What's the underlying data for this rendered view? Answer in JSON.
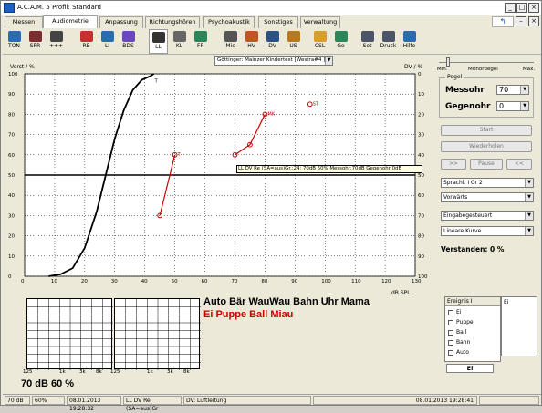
{
  "window": {
    "title": "A.C.A.M. 5  Profil: Standard"
  },
  "tabs": [
    {
      "label": "Messen",
      "active": false
    },
    {
      "label": "Audiometrie",
      "active": true
    },
    {
      "label": "Anpassung",
      "active": false
    },
    {
      "label": "Richtungshören",
      "active": false
    },
    {
      "label": "Psychoakustik",
      "active": false
    },
    {
      "label": "Sonstiges",
      "active": false
    },
    {
      "label": "Verwaltung",
      "active": false
    }
  ],
  "toolbar": [
    {
      "label": "TON",
      "icon": "tone-icon"
    },
    {
      "label": "SPR",
      "icon": "speech-icon"
    },
    {
      "label": "+++",
      "icon": "plus-icon"
    },
    {
      "label": "RE",
      "icon": "ear-right-icon"
    },
    {
      "label": "LI",
      "icon": "ear-left-icon"
    },
    {
      "label": "BDS",
      "icon": "ears-both-icon"
    },
    {
      "label": "LL",
      "icon": "headphones-icon",
      "selected": true
    },
    {
      "label": "KL",
      "icon": "bone-icon"
    },
    {
      "label": "FF",
      "icon": "speaker-icon"
    },
    {
      "label": "Mic",
      "icon": "mic-icon"
    },
    {
      "label": "HV",
      "icon": "hv-icon"
    },
    {
      "label": "DV",
      "icon": "dv-icon"
    },
    {
      "label": "US",
      "icon": "us-icon"
    },
    {
      "label": "CSL",
      "icon": "smiley-icon"
    },
    {
      "label": "Go",
      "icon": "go-icon"
    },
    {
      "label": "Set",
      "icon": "tools-icon"
    },
    {
      "label": "Druck",
      "icon": "printer-icon"
    },
    {
      "label": "Hilfe",
      "icon": "help-icon"
    }
  ],
  "test_select": {
    "value": "Göttinger: Mainzer Kindertest [Westra#4 ]"
  },
  "slider": {
    "min_label": "Min.",
    "mid_label": "Mithörpegel",
    "max_label": "Max."
  },
  "pegel": {
    "title": "Pegel",
    "messohr_label": "Messohr",
    "messohr_value": "70",
    "gegenohr_label": "Gegenohr",
    "gegenohr_value": "0"
  },
  "buttons": {
    "start": "Start",
    "wiederholen": "Wiederholen",
    "back": ">>",
    "pause": "Pause",
    "fwd": "<<"
  },
  "dropdowns": [
    "Sprachl. I Gr 2",
    "Vorwärts",
    "Eingabegesteuert",
    "Lineare Kurve"
  ],
  "verstanden": "Verstanden: 0 %",
  "words": {
    "line1": "Auto Bär WauWau Bahn Uhr Mama",
    "line2": "Ei Puppe Ball Miau"
  },
  "events": {
    "header": "Ereignis I",
    "items": [
      "Ei",
      "Puppe",
      "Ball",
      "Bahn",
      "Auto"
    ],
    "right_text": "Ei",
    "current": "Ei"
  },
  "small_result": "70 dB   60 %",
  "tooltip": "LL DV Re (SA=aus)Gr.:24:  70dB  60% Messohr:70dB Gegenohr:0dB",
  "status": [
    "70 dB",
    "60%",
    "08.01.2013 19:28:32",
    "LL DV Re (SA=aus)Gr",
    "DV: Luftleitung",
    "08.01.2013 19:28:41"
  ],
  "mini_axis": {
    "x_ticks": [
      "125",
      "1k",
      "3k",
      "8k"
    ]
  },
  "chart_data": {
    "type": "line",
    "xlabel": "dB SPL",
    "ylabel_left": "Verst / %",
    "ylabel_right": "DV / %",
    "xlim": [
      0,
      130
    ],
    "ylim": [
      0,
      100
    ],
    "x_ticks": [
      0,
      10,
      20,
      30,
      40,
      50,
      60,
      70,
      80,
      90,
      100,
      110,
      120,
      130
    ],
    "y_ticks_left": [
      0,
      10,
      20,
      30,
      40,
      50,
      60,
      70,
      80,
      90,
      100
    ],
    "y_ticks_right": [
      100,
      90,
      80,
      70,
      60,
      50,
      40,
      30,
      20,
      10,
      0
    ],
    "norm_curve": [
      [
        8,
        0
      ],
      [
        12,
        1
      ],
      [
        16,
        4
      ],
      [
        20,
        14
      ],
      [
        24,
        32
      ],
      [
        27,
        50
      ],
      [
        30,
        68
      ],
      [
        33,
        82
      ],
      [
        36,
        92
      ],
      [
        39,
        97
      ],
      [
        42,
        99
      ],
      [
        43,
        100
      ]
    ],
    "reference_line_y": 50,
    "series": [
      {
        "color": "#cc0000",
        "points": [
          [
            45,
            30
          ],
          [
            50,
            60
          ]
        ],
        "labels": [
          "T"
        ]
      },
      {
        "color": "#cc0000",
        "points": [
          [
            70,
            60
          ],
          [
            75,
            65
          ],
          [
            80,
            80
          ]
        ],
        "labels": [
          "MK"
        ]
      },
      {
        "color": "#cc0000",
        "points": [
          [
            95,
            85
          ]
        ],
        "labels": [
          "ST"
        ]
      }
    ]
  }
}
